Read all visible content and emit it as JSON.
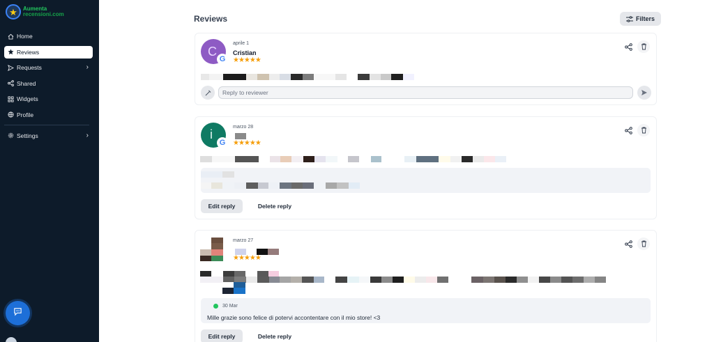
{
  "brand": {
    "line1": "Aumenta",
    "line2": "recensioni.com"
  },
  "nav": {
    "items": [
      {
        "label": "Home",
        "icon": "home-icon"
      },
      {
        "label": "Reviews",
        "icon": "star-icon",
        "active": true
      },
      {
        "label": "Requests",
        "icon": "send-icon",
        "has_submenu": true
      },
      {
        "label": "Shared",
        "icon": "share-icon"
      },
      {
        "label": "Widgets",
        "icon": "grid-icon"
      },
      {
        "label": "Profile",
        "icon": "globe-icon"
      },
      {
        "label": "Settings",
        "icon": "gear-icon",
        "has_submenu": true
      }
    ]
  },
  "page": {
    "title": "Reviews",
    "filters_label": "Filters"
  },
  "reviews": [
    {
      "date": "aprile 1",
      "name": "Cristian",
      "stars": "★★★★★",
      "source_icon": "google-icon",
      "reply_placeholder": "Reply to reviewer"
    },
    {
      "date": "marzo 28",
      "name": "",
      "stars": "★★★★★",
      "source_icon": "google-icon",
      "edit_label": "Edit reply",
      "delete_label": "Delete reply"
    },
    {
      "date": "marzo 27",
      "name": "",
      "stars": "★★★★★",
      "reply": {
        "date": "30 Mar",
        "text": "Mille grazie sono felice di potervi accontentare con il mio store! <3"
      },
      "edit_label": "Edit reply",
      "delete_label": "Delete reply"
    }
  ],
  "colors": {
    "sidebar": "#0d1b2a",
    "accent": "#1d6fd8",
    "star": "#f59e0b",
    "success": "#22c55e"
  }
}
